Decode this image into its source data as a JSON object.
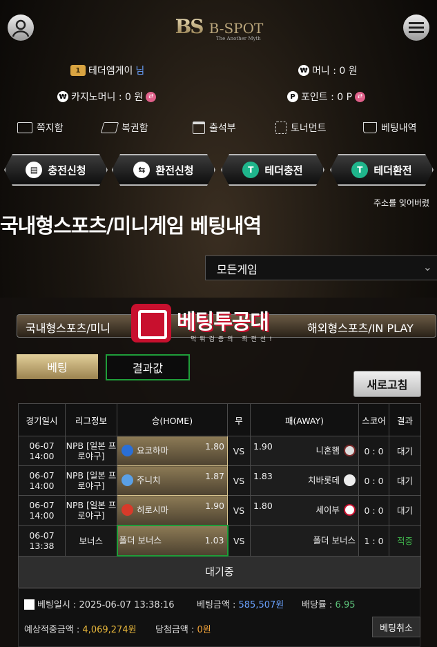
{
  "header": {
    "logo_mark": "BS",
    "logo_name": "B-SPOT",
    "logo_tagline": "The Another Myth",
    "user_badge": "1",
    "user_name": "테더엠게이",
    "user_suffix": "님",
    "money_label": "머니 : 0 원",
    "casino_label": "카지노머니 : 0 원",
    "point_label": "포인트 : 0 P"
  },
  "nav": [
    {
      "label": "쪽지함",
      "icon": "envelope-icon"
    },
    {
      "label": "복권함",
      "icon": "lottery-ticket-icon"
    },
    {
      "label": "출석부",
      "icon": "calendar-icon"
    },
    {
      "label": "토너먼트",
      "icon": "tournament-icon"
    },
    {
      "label": "베팅내역",
      "icon": "cart-icon"
    }
  ],
  "actions": [
    {
      "label": "충전신청",
      "icon": "deposit-icon"
    },
    {
      "label": "환전신청",
      "icon": "exchange-icon"
    },
    {
      "label": "테더충전",
      "icon": "tether-icon"
    },
    {
      "label": "테더환전",
      "icon": "tether-icon"
    }
  ],
  "marquee": "주소를 잊어버렸",
  "page_title": "국내형스포츠/미니게임 베팅내역",
  "game_filter": {
    "selected": "모든게임"
  },
  "tabs": {
    "left": "국내형스포츠/미니",
    "right": "해외형스포츠/IN PLAY"
  },
  "watermark": {
    "title": "베팅투공대",
    "subtitle": "먹튀검증의 최전선!"
  },
  "buttons": {
    "bet": "베팅",
    "result": "결과값",
    "refresh": "새로고침",
    "cancel": "베팅취소"
  },
  "table": {
    "headers": [
      "경기일시",
      "리그정보",
      "승(HOME)",
      "무",
      "패(AWAY)",
      "스코어",
      "결과"
    ],
    "rows": [
      {
        "date": "06-07",
        "time": "14:00",
        "league": "NPB [일본 프로야구]",
        "home": "요코하마",
        "home_odds": "1.80",
        "draw": "VS",
        "away_odds": "1.90",
        "away": "니혼햄",
        "score": "0 : 0",
        "result": "대기",
        "selected": "home"
      },
      {
        "date": "06-07",
        "time": "14:00",
        "league": "NPB [일본 프로야구]",
        "home": "주니치",
        "home_odds": "1.87",
        "draw": "VS",
        "away_odds": "1.83",
        "away": "치바롯데",
        "score": "0 : 0",
        "result": "대기",
        "selected": "home"
      },
      {
        "date": "06-07",
        "time": "14:00",
        "league": "NPB [일본 프로야구]",
        "home": "히로시마",
        "home_odds": "1.90",
        "draw": "VS",
        "away_odds": "1.80",
        "away": "세이부",
        "score": "0 : 0",
        "result": "대기",
        "selected": "home"
      },
      {
        "date": "06-07",
        "time": "13:38",
        "league": "보너스",
        "home": "폴더 보너스",
        "home_odds": "1.03",
        "draw": "VS",
        "away_odds": "",
        "away": "폴더 보너스",
        "score": "1 : 0",
        "result": "적중",
        "selected": "home"
      }
    ],
    "status": "대기중"
  },
  "summary": {
    "bet_time_label": "베팅일시 :",
    "bet_time": "2025-06-07 13:38:16",
    "bet_amount_label": "베팅금액 :",
    "bet_amount": "585,507원",
    "odds_label": "배당률 :",
    "odds": "6.95",
    "expected_label": "예상적중금액 :",
    "expected": "4,069,274원",
    "win_label": "당첨금액 :",
    "win": "0원"
  },
  "colors": {
    "accent_gold": "#c9b48a",
    "win_green": "#3fb54b",
    "selected_border": "#1f9e3a",
    "pink_badge": "#e0608a"
  }
}
